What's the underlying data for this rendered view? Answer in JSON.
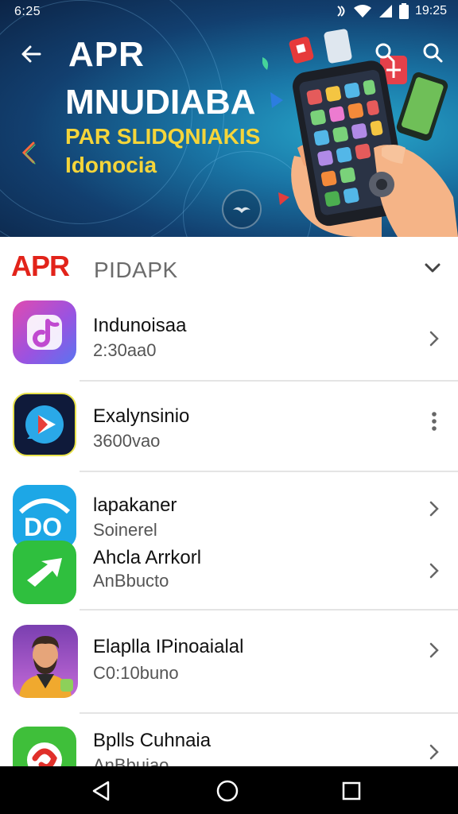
{
  "status_bar": {
    "time": "6:25",
    "clock_right": "19:25",
    "icons": [
      "nfc-icon",
      "wifi-icon",
      "signal-icon",
      "battery-icon"
    ]
  },
  "hero": {
    "title_line1": "APR",
    "title_line2": "MNUDIABA",
    "subtitle_line1": "PAR SLIDQNIAKIS",
    "subtitle_line2": "Idonocia",
    "colors": {
      "background": "#123f6f",
      "accent_yellow": "#f5d53a"
    }
  },
  "section": {
    "brand": "APR",
    "title": "PIDAPK",
    "brand_color": "#e2231a"
  },
  "apps": [
    {
      "title": "Indunoisaa",
      "subtitle": "2:30aa0",
      "icon": "music-note-icon",
      "action": "chevron-right"
    },
    {
      "title": "Exalynsinio",
      "subtitle": "3600vao",
      "icon": "play-store-icon",
      "action": "more-vert"
    },
    {
      "title": "lapakaner",
      "subtitle": "Soinerel",
      "icon": "do-logo-icon",
      "action": "chevron-right"
    },
    {
      "title": "Ahcla Arrkorl",
      "subtitle": "AnBbucto",
      "icon": "green-bird-icon",
      "action": "chevron-right"
    },
    {
      "title": "Elaplla IPinoaialal",
      "subtitle": "C0:10buno",
      "icon": "avatar-man-icon",
      "action": "chevron-right"
    },
    {
      "title": "Bplls Cuhnaia",
      "subtitle": "AnBbuiao",
      "icon": "red-swirl-icon",
      "action": "chevron-right"
    }
  ],
  "nav": {
    "buttons": [
      "back-nav-icon",
      "home-nav-icon",
      "recents-nav-icon"
    ]
  }
}
